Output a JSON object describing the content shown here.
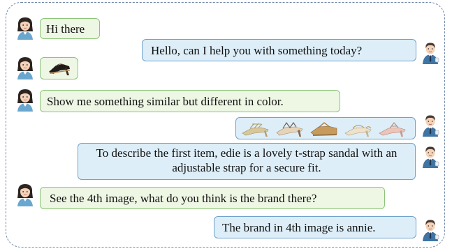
{
  "messages": [
    {
      "role": "user",
      "text": "Hi there"
    },
    {
      "role": "assistant",
      "text": "Hello, can I help you with something today?"
    },
    {
      "role": "user",
      "image": "black-heeled-sandal"
    },
    {
      "role": "user",
      "text": "Show me something similar but different in color."
    },
    {
      "role": "assistant",
      "images": [
        "gold-strappy-sandal",
        "beige-strappy-sandal",
        "tan-wedge-sandal",
        "beige-slingback-heel",
        "pink-t-strap-sandal"
      ]
    },
    {
      "role": "assistant",
      "text": "To describe the first item, edie is a lovely t-strap sandal with an adjustable strap for a secure fit."
    },
    {
      "role": "user",
      "text": "See the 4th image, what do you think is the brand there?"
    },
    {
      "role": "assistant",
      "text": "The brand in 4th image is annie."
    }
  ],
  "colors": {
    "user_bubble": "#eef6e4",
    "user_border": "#8cc47a",
    "assistant_bubble": "#ddeef8",
    "assistant_border": "#6fa3cc",
    "frame_border": "#6f86a8"
  }
}
